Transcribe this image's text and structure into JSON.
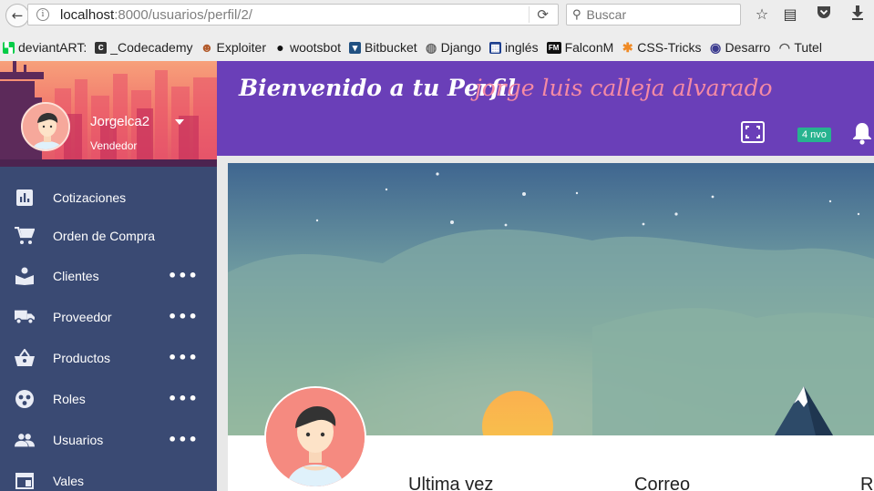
{
  "browser": {
    "url_host": "localhost",
    "url_rest": ":8000/usuarios/perfil/2/",
    "search_placeholder": "Buscar",
    "bookmarks": [
      {
        "label": "deviantART:",
        "icon": "deviantart-icon",
        "color": "#05cc47"
      },
      {
        "label": "_Codecademy",
        "icon": "codecademy-icon",
        "color": "#333333"
      },
      {
        "label": "Exploiter",
        "icon": "exploiter-icon",
        "color": "#b25a2b"
      },
      {
        "label": "wootsbot",
        "icon": "github-icon",
        "color": "#111111"
      },
      {
        "label": "Bitbucket",
        "icon": "bitbucket-icon",
        "color": "#205081"
      },
      {
        "label": "Django",
        "icon": "globe-icon",
        "color": "#666666"
      },
      {
        "label": "inglés",
        "icon": "flag-icon",
        "color": "#1d3f8f"
      },
      {
        "label": "FalconM",
        "icon": "fm-icon",
        "color": "#111111"
      },
      {
        "label": "CSS-Tricks",
        "icon": "asterisk-icon",
        "color": "#f08a24"
      },
      {
        "label": "Desarro",
        "icon": "eye-icon",
        "color": "#3b3b8f"
      },
      {
        "label": "Tutel",
        "icon": "mask-icon",
        "color": "#555555"
      }
    ]
  },
  "sidebar": {
    "username": "Jorgelca2",
    "role": "Vendedor",
    "items": [
      {
        "label": "Cotizaciones",
        "icon": "bar-chart-icon",
        "more": ""
      },
      {
        "label": "Orden de Compra",
        "icon": "cart-icon",
        "more": ""
      },
      {
        "label": "Clientes",
        "icon": "reader-icon",
        "more": "•••"
      },
      {
        "label": "Proveedor",
        "icon": "truck-icon",
        "more": "•••"
      },
      {
        "label": "Productos",
        "icon": "basket-icon",
        "more": "•••"
      },
      {
        "label": "Roles",
        "icon": "roles-icon",
        "more": "•••"
      },
      {
        "label": "Usuarios",
        "icon": "people-icon",
        "more": "•••"
      },
      {
        "label": "Vales",
        "icon": "window-icon",
        "more": ""
      }
    ]
  },
  "header": {
    "welcome": "Bienvenido a tu Perfil",
    "full_name": "jorge luis calleja alvarado",
    "badge": "4 nvo"
  },
  "profile": {
    "labels": [
      "Ultima vez",
      "Correo",
      "R"
    ]
  },
  "colors": {
    "sidebar": "#3a4a73",
    "topbar": "#6a3fb8",
    "name_accent": "#f58aa4",
    "badge": "#27b38f"
  }
}
